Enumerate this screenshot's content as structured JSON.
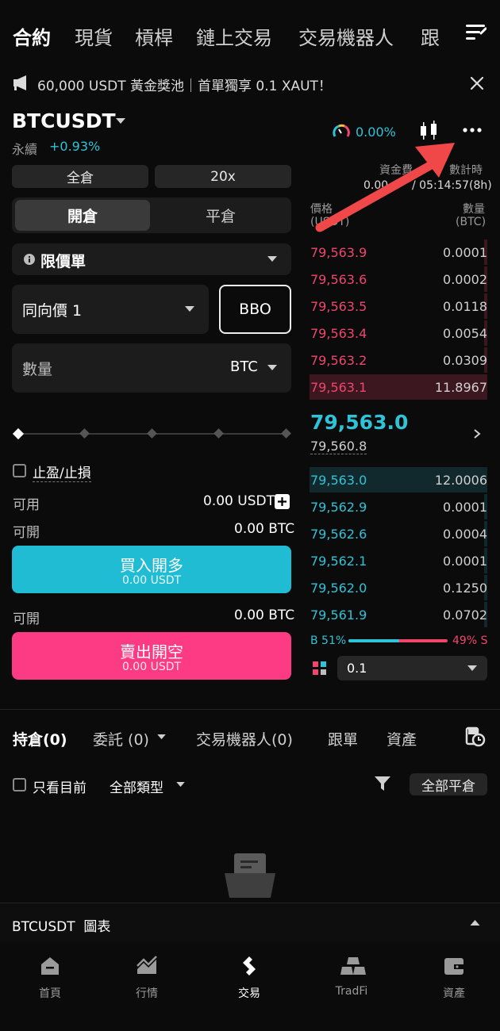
{
  "nav": {
    "tabs": [
      "合約",
      "現貨",
      "槓桿",
      "鏈上交易",
      "交易機器人",
      "跟"
    ]
  },
  "banner": {
    "text": "60,000 USDT 黃金獎池｜首單獨享 0.1 XAUT！"
  },
  "header": {
    "symbol": "BTCUSDT",
    "type": "永續",
    "change": "+0.93%",
    "gauge_value": "0.00%"
  },
  "funding": {
    "label": "資金費率 / 倒數計時",
    "label_left": "資金費",
    "label_right": "數計時",
    "value": "0.00",
    "countdown": "/ 05:14:57(8h)"
  },
  "order_form": {
    "margin_mode": "全倉",
    "leverage": "20x",
    "open_tab": "開倉",
    "close_tab": "平倉",
    "order_type": "限價單",
    "price_mode": "同向價 1",
    "bbo": "BBO",
    "qty_label": "數量",
    "qty_unit": "BTC",
    "tpsl": "止盈/止損",
    "avail_label": "可用",
    "avail_value": "0.00 USDT",
    "open_label": "可開",
    "open_value": "0.00 BTC",
    "buy_label": "買入開多",
    "buy_sub": "0.00 USDT",
    "open_label2": "可開",
    "open_value2": "0.00 BTC",
    "sell_label": "賣出開空",
    "sell_sub": "0.00 USDT"
  },
  "orderbook": {
    "price_header": "價格",
    "price_unit": "(USDT)",
    "qty_header": "數量",
    "qty_unit": "(BTC)",
    "asks": [
      {
        "price": "79,563.9",
        "qty": "0.0001"
      },
      {
        "price": "79,563.6",
        "qty": "0.0002"
      },
      {
        "price": "79,563.5",
        "qty": "0.0118"
      },
      {
        "price": "79,563.4",
        "qty": "0.0054"
      },
      {
        "price": "79,563.2",
        "qty": "0.0309"
      },
      {
        "price": "79,563.1",
        "qty": "11.8967"
      }
    ],
    "last_price": "79,563.0",
    "mark_price": "79,560.8",
    "bids": [
      {
        "price": "79,563.0",
        "qty": "12.0006"
      },
      {
        "price": "79,562.9",
        "qty": "0.0001"
      },
      {
        "price": "79,562.6",
        "qty": "0.0004"
      },
      {
        "price": "79,562.1",
        "qty": "0.0001"
      },
      {
        "price": "79,562.0",
        "qty": "0.1250"
      },
      {
        "price": "79,561.9",
        "qty": "0.0702"
      }
    ],
    "buy_ratio": "B 51%",
    "sell_ratio": "49% S",
    "buy_ratio_value": 51,
    "precision": "0.1"
  },
  "positions": {
    "tabs": [
      "持倉(0)",
      "委託 (0)",
      "交易機器人(0)",
      "跟單",
      "資產"
    ],
    "only_current": "只看目前",
    "all_types": "全部類型",
    "close_all": "全部平倉"
  },
  "chart_bar": {
    "label": "BTCUSDT  圖表"
  },
  "bottom_nav": {
    "items": [
      "首頁",
      "行情",
      "交易",
      "TradFi",
      "資產"
    ]
  },
  "colors": {
    "accent_cyan": "#1fbcd3",
    "accent_pink": "#fd3a84",
    "ask_red": "#f0466e",
    "bid_cyan": "#2fc3d8",
    "annotation_arrow": "#f04848"
  }
}
